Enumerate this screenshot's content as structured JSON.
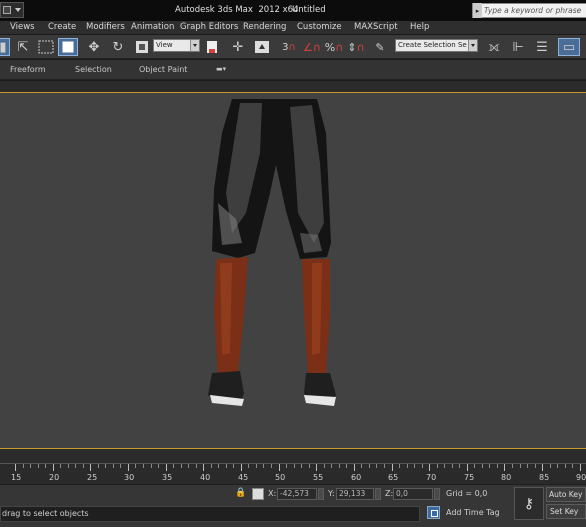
{
  "titlebar": {
    "app_title": "Autodesk 3ds Max  2012 x64",
    "doc_title": "Untitled",
    "search_placeholder": "Type a keyword or phrase"
  },
  "menu": [
    "Views",
    "Create",
    "Modifiers",
    "Animation",
    "Graph Editors",
    "Rendering",
    "Customize",
    "MAXScript",
    "Help"
  ],
  "toolbar": {
    "reference_coord": "View",
    "named_selection": "Create Selection Se",
    "snap_value": "3",
    "icons": [
      "selection-filter-icon",
      "select-object-icon",
      "rect-selection-region-icon",
      "window-crossing-icon",
      "select-and-move-icon",
      "select-and-rotate-icon",
      "select-and-scale-icon",
      "reference-coordinate-icon",
      "select-by-name-icon",
      "use-pivot-center-icon",
      "select-and-manipulate-icon",
      "snaps-toggle-icon",
      "angle-snap-icon",
      "percent-snap-icon",
      "spinner-snap-icon",
      "edit-named-selection-icon",
      "mirror-icon",
      "align-icon",
      "layer-manager-icon",
      "graphite-toggle-icon"
    ]
  },
  "ribbon": {
    "tabs": [
      "Freeform",
      "Selection",
      "Object Paint"
    ]
  },
  "timeline": {
    "labels": [
      "15",
      "20",
      "25",
      "30",
      "35",
      "40",
      "45",
      "50",
      "55",
      "60",
      "65",
      "70",
      "75",
      "80",
      "85",
      "90"
    ]
  },
  "status": {
    "x_label": "X:",
    "x_value": "-42,573",
    "y_label": "Y:",
    "y_value": "29,133",
    "z_label": "Z:",
    "z_value": "0,0",
    "grid": "Grid = 0,0",
    "message": "drag to select objects",
    "add_time_tag": "Add Time Tag",
    "auto_key": "Auto Key",
    "set_key": "Set Key"
  },
  "colors": {
    "viewport_bg": "#424242",
    "viewport_border": "#c69a2c",
    "active_tool": "#4a6d98",
    "snap_red": "#d6423a"
  }
}
